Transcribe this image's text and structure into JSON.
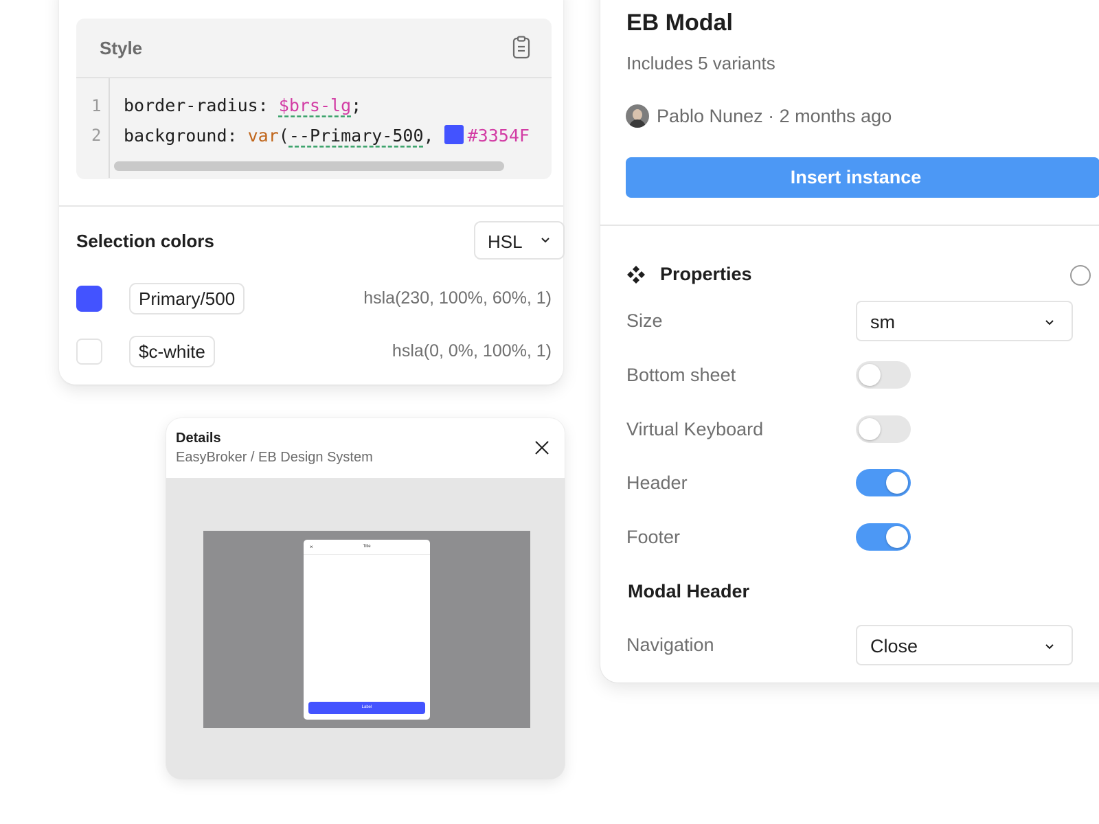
{
  "inspect": {
    "style_title": "Style",
    "code": {
      "line_numbers": [
        "1",
        "2"
      ],
      "line1": {
        "prop": "border-radius",
        "sep": ": ",
        "value": "$brs-lg",
        "end": ";"
      },
      "line2": {
        "prop": "background",
        "sep": ": ",
        "fn": "var",
        "open": "(",
        "var": "--Primary-500",
        "comma": ", ",
        "hex": "#3354F"
      }
    },
    "selection_colors": {
      "title": "Selection colors",
      "format_select": "HSL",
      "colors": [
        {
          "name": "Primary/500",
          "value": "hsla(230, 100%, 60%, 1)",
          "swatch": "#4353ff"
        },
        {
          "name": "$c-white",
          "value": "hsla(0, 0%, 100%, 1)",
          "swatch": "#ffffff"
        }
      ]
    }
  },
  "details": {
    "title": "Details",
    "path": "EasyBroker / EB Design System",
    "preview": {
      "close_glyph": "×",
      "title": "Title",
      "button_label": "Label",
      "button_color": "#4353ff"
    }
  },
  "component": {
    "title": "EB Modal",
    "subtitle": "Includes 5 variants",
    "author": "Pablo Nunez · 2 months ago",
    "insert_button": "Insert instance",
    "accent": "#4c98f5",
    "properties_title": "Properties",
    "properties": [
      {
        "label": "Size",
        "type": "select",
        "value": "sm"
      },
      {
        "label": "Bottom sheet",
        "type": "toggle",
        "on": false
      },
      {
        "label": "Virtual Keyboard",
        "type": "toggle",
        "on": false
      },
      {
        "label": "Header",
        "type": "toggle",
        "on": true
      },
      {
        "label": "Footer",
        "type": "toggle",
        "on": true
      }
    ],
    "modal_header_section": "Modal Header",
    "navigation": {
      "label": "Navigation",
      "value": "Close"
    }
  }
}
